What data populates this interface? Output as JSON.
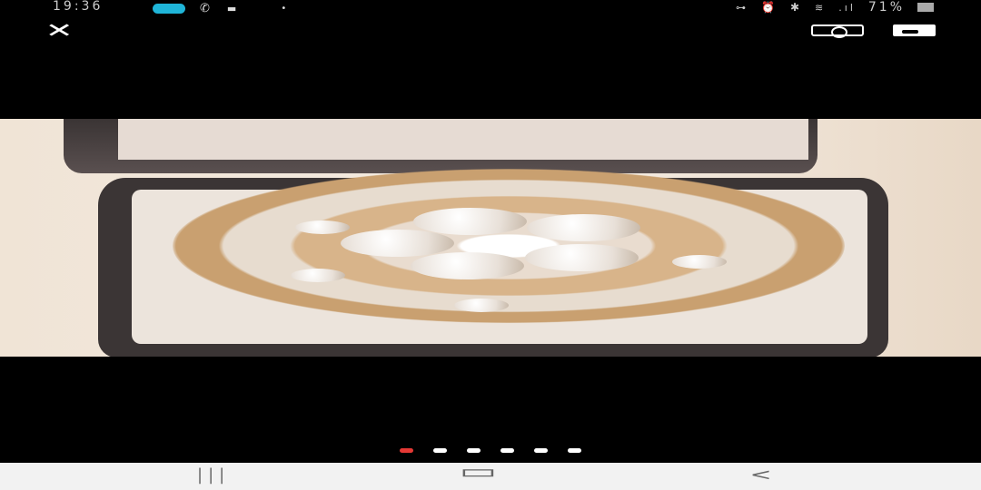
{
  "status_bar": {
    "time": "19:36",
    "battery": "71%",
    "icons": [
      "link-pill-icon",
      "viber-icon",
      "notification-icon",
      "dot-icon",
      "key-icon",
      "alarm-icon",
      "bluetooth-icon",
      "wifi-icon",
      "signal-icon",
      "battery-icon"
    ]
  },
  "toolbar": {
    "close": "✕",
    "icons": [
      "close-icon",
      "camera-icon",
      "save-icon"
    ]
  },
  "viewer": {
    "image": "pearl rhinestone brooch in box",
    "page_count": 6,
    "active_index": 0
  },
  "nav": {
    "recent": "|||",
    "home": "▭",
    "back": "<"
  }
}
